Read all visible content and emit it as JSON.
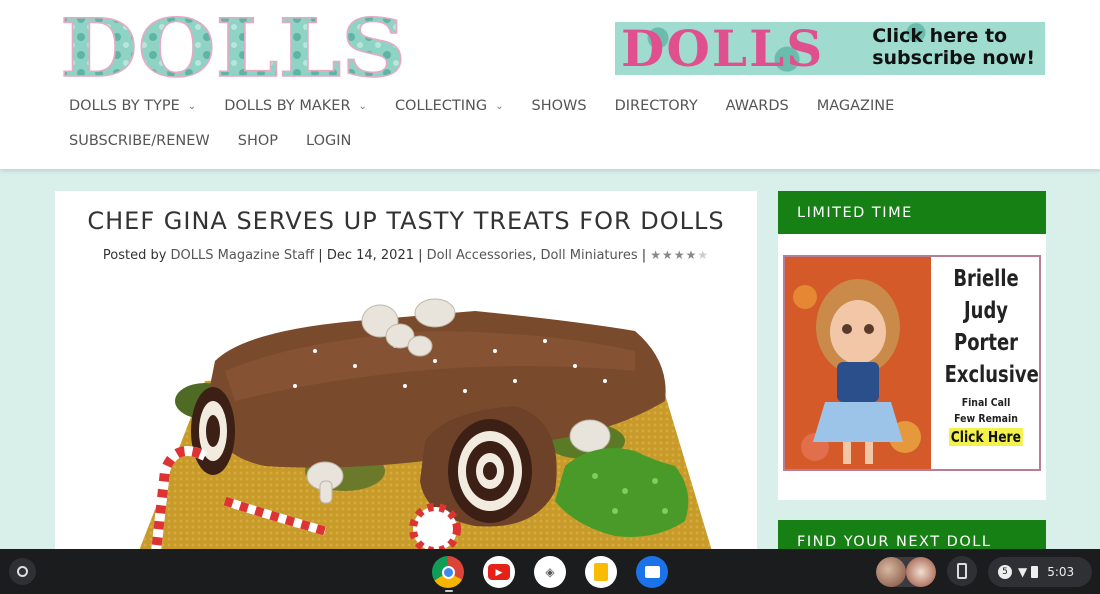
{
  "header": {
    "logo_text": "DOLLS",
    "banner": {
      "brand": "DOLLS",
      "cta_line1": "Click here to",
      "cta_line2": "subscribe now!"
    }
  },
  "nav": {
    "row1": [
      {
        "label": "DOLLS BY TYPE",
        "dropdown": true
      },
      {
        "label": "DOLLS BY MAKER",
        "dropdown": true
      },
      {
        "label": "COLLECTING",
        "dropdown": true
      },
      {
        "label": "SHOWS"
      },
      {
        "label": "DIRECTORY"
      },
      {
        "label": "AWARDS"
      },
      {
        "label": "MAGAZINE"
      }
    ],
    "row2": [
      {
        "label": "SUBSCRIBE/RENEW"
      },
      {
        "label": "SHOP"
      },
      {
        "label": "LOGIN"
      }
    ]
  },
  "article": {
    "title": "CHEF GINA SERVES UP TASTY TREATS FOR DOLLS",
    "meta": {
      "posted_by": "Posted by",
      "author": "DOLLS Magazine Staff",
      "sep": "|",
      "date": "Dec 14, 2021",
      "category1": "Doll Accessories",
      "comma": ",",
      "category2": "Doll Miniatures",
      "rating_text": "★★★★★",
      "rating": 4
    }
  },
  "sidebar": {
    "widget1": {
      "heading": "LIMITED TIME",
      "ad": {
        "line1": "Brielle",
        "line2": "Judy",
        "line3": "Porter",
        "line4": "Exclusive",
        "small1": "Final Call",
        "small2": "Few Remain",
        "click": "Click Here"
      }
    },
    "widget2": {
      "heading": "FIND YOUR NEXT DOLL"
    }
  },
  "taskbar": {
    "notification_count": "5",
    "time": "5:03"
  },
  "colors": {
    "page_bg": "#d9efea",
    "widget_green": "#178015",
    "logo_pink": "#e0508f",
    "logo_teal": "#8fd3c5"
  }
}
